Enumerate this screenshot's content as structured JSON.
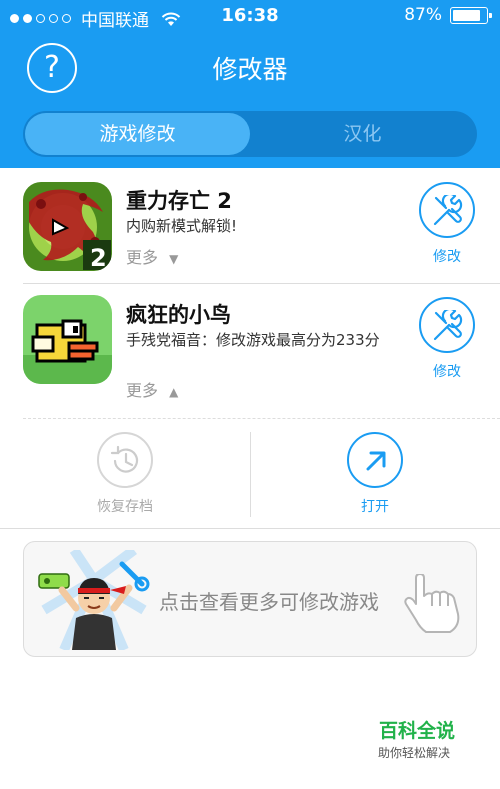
{
  "status_bar": {
    "carrier": "中国联通",
    "time": "16:38",
    "battery": "87%",
    "battery_level": 0.87,
    "signal_bars": 2,
    "signal_total": 5
  },
  "header": {
    "title": "修改器",
    "help_icon": "question-circle-icon",
    "tabs": [
      {
        "label": "游戏修改",
        "active": true
      },
      {
        "label": "汉化",
        "active": false
      }
    ]
  },
  "games": [
    {
      "name": "重力存亡 2",
      "description": "内购新模式解锁!",
      "more_label": "更多",
      "more_arrow": "▼",
      "action_label": "修改",
      "action_icon": "wrench-screwdriver-icon"
    },
    {
      "name": "疯狂的小鸟",
      "description": "手残党福音：修改游戏最高分为233分",
      "more_label": "更多",
      "more_arrow": "▲",
      "action_label": "修改",
      "action_icon": "wrench-screwdriver-icon"
    }
  ],
  "expanded_actions": [
    {
      "label": "恢复存档",
      "icon": "restore-clock-icon",
      "color": "#aaaaaa"
    },
    {
      "label": "打开",
      "icon": "arrow-up-right-icon",
      "color": "#1a9cf2"
    }
  ],
  "banner": {
    "text": "点击查看更多可修改游戏",
    "hand_icon": "pointing-hand-icon"
  },
  "watermark": {
    "main": "百科全说",
    "sub": "助你轻松解决"
  },
  "colors": {
    "accent": "#1a9cf2",
    "watermark_green": "#21b24a"
  }
}
